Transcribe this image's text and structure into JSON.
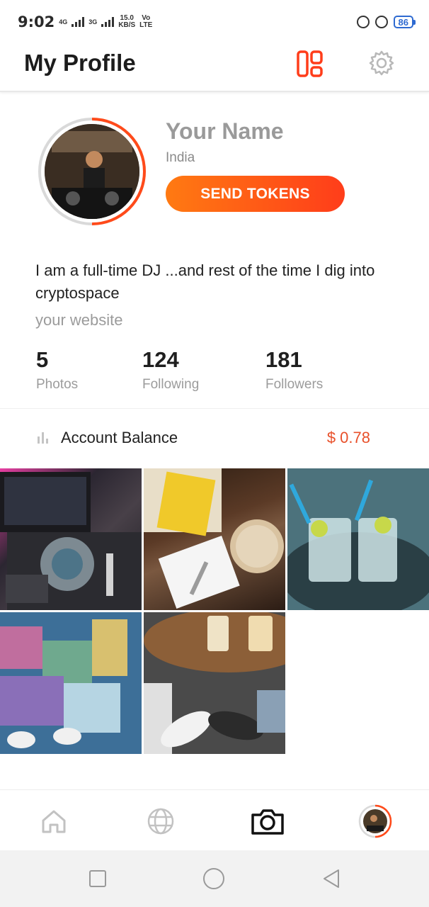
{
  "status_bar": {
    "time": "9:02",
    "net_a": "4G",
    "net_b": "3G",
    "speed_value": "15.0",
    "speed_unit": "KB/S",
    "volte_top": "Vo",
    "volte_bottom": "LTE",
    "battery": "86"
  },
  "header": {
    "title": "My Profile",
    "grid_icon": "grid-layout-icon",
    "settings_icon": "gear-icon",
    "accent_color": "#ff3d1a"
  },
  "profile": {
    "name": "Your Name",
    "country": "India",
    "send_button_label": "SEND TOKENS",
    "bio": "I am a full-time DJ ...and rest of the time I dig into cryptospace",
    "website": "your website"
  },
  "stats": [
    {
      "value": "5",
      "label": "Photos"
    },
    {
      "value": "124",
      "label": "Following"
    },
    {
      "value": "181",
      "label": "Followers"
    }
  ],
  "balance": {
    "label": "Account Balance",
    "value": "$ 0.78",
    "icon": "bar-chart-icon"
  },
  "photos": [
    {
      "name": "dj-controller-photo"
    },
    {
      "name": "drink-snack-photo"
    },
    {
      "name": "mojito-glasses-photo"
    },
    {
      "name": "patchwork-chair-photo"
    },
    {
      "name": "shoes-table-photo"
    }
  ],
  "bottom_nav": [
    {
      "icon": "home-icon",
      "active": false
    },
    {
      "icon": "globe-icon",
      "active": false
    },
    {
      "icon": "camera-icon",
      "active": true
    },
    {
      "icon": "profile-avatar-icon",
      "active": false
    }
  ],
  "system_nav": [
    "recents-square-icon",
    "home-circle-icon",
    "back-triangle-icon"
  ]
}
